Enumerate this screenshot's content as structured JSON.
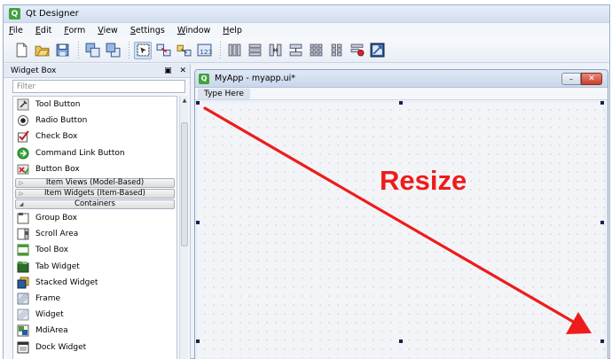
{
  "app": {
    "title": "Qt Designer",
    "logo": "Q"
  },
  "menubar": {
    "items": [
      "File",
      "Edit",
      "Form",
      "View",
      "Settings",
      "Window",
      "Help"
    ]
  },
  "toolbar": {
    "groups": [
      [
        "new-file-icon",
        "open-file-icon",
        "save-file-icon"
      ],
      [
        "send-back-icon",
        "bring-front-icon"
      ],
      [
        "edit-widgets-icon",
        "edit-signals-icon",
        "edit-buddies-icon",
        "edit-tab-order-icon"
      ],
      [
        "layout-horizontal-icon",
        "layout-vertical-icon",
        "layout-h-splitter-icon",
        "layout-v-splitter-icon",
        "layout-grid-icon",
        "layout-form-icon",
        "break-layout-icon",
        "adjust-size-icon"
      ]
    ]
  },
  "widgetbox": {
    "title": "Widget Box",
    "filter_placeholder": "Filter",
    "items_top": [
      {
        "label": "Tool Button",
        "icon": "tool-button-icon"
      },
      {
        "label": "Radio Button",
        "icon": "radio-button-icon"
      },
      {
        "label": "Check Box",
        "icon": "check-box-icon"
      },
      {
        "label": "Command Link Button",
        "icon": "command-link-icon"
      },
      {
        "label": "Button Box",
        "icon": "button-box-icon"
      }
    ],
    "categories": [
      {
        "label": "Item Views (Model-Based)",
        "expanded": false
      },
      {
        "label": "Item Widgets (Item-Based)",
        "expanded": false
      },
      {
        "label": "Containers",
        "expanded": true
      }
    ],
    "items_containers": [
      {
        "label": "Group Box",
        "icon": "group-box-icon"
      },
      {
        "label": "Scroll Area",
        "icon": "scroll-area-icon"
      },
      {
        "label": "Tool Box",
        "icon": "tool-box-icon"
      },
      {
        "label": "Tab Widget",
        "icon": "tab-widget-icon"
      },
      {
        "label": "Stacked Widget",
        "icon": "stacked-widget-icon"
      },
      {
        "label": "Frame",
        "icon": "frame-icon"
      },
      {
        "label": "Widget",
        "icon": "widget-icon"
      },
      {
        "label": "MdiArea",
        "icon": "mdi-area-icon"
      },
      {
        "label": "Dock Widget",
        "icon": "dock-widget-icon"
      }
    ]
  },
  "form": {
    "title": "MyApp - myapp.ui*",
    "menu_placeholder": "Type Here"
  },
  "annotation": {
    "text": "Resize",
    "color": "#ee1c1c"
  }
}
